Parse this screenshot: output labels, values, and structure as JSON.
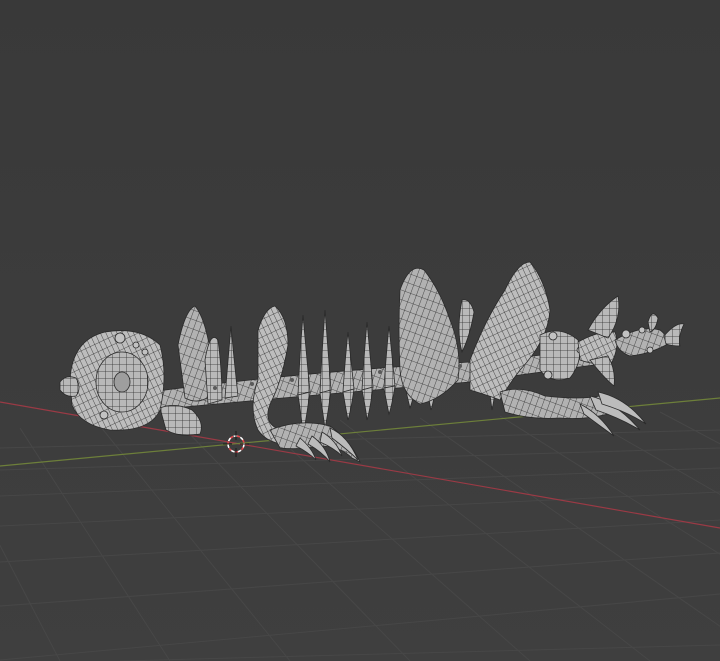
{
  "viewport": {
    "background_top": "#393939",
    "background_bottom": "#3f3f3f",
    "grid_color": "#4a4a4a",
    "axis_x_color": "#9a3a45",
    "axis_y_color": "#6d7f3a",
    "cursor_color_primary": "#ffffff",
    "cursor_color_secondary": "#e0474c"
  },
  "model": {
    "fill": "#b4b4b4",
    "fill_light": "#cfcfcf",
    "wire": "#2a2a2a",
    "shadow": "#7a7a7a"
  },
  "icons": {
    "cursor": "3d-cursor-icon"
  }
}
